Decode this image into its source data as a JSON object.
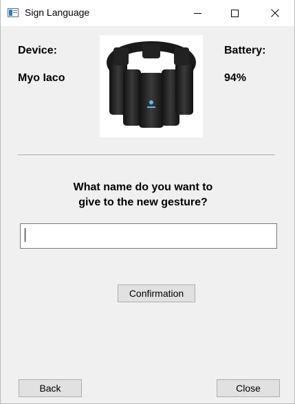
{
  "window": {
    "title": "Sign Language",
    "controls": {
      "minimize": "minimize-icon",
      "maximize": "maximize-icon",
      "close": "close-icon"
    }
  },
  "device": {
    "label": "Device:",
    "name": "Myo Iaco",
    "image_icon": "myo-armband-image"
  },
  "battery": {
    "label": "Battery:",
    "value": "94%"
  },
  "prompt": {
    "line1": "What name do you want to",
    "line2": "give to the new gesture?"
  },
  "gesture_name_input": {
    "value": "",
    "placeholder": ""
  },
  "buttons": {
    "confirm": "Confirmation",
    "back": "Back",
    "close": "Close"
  },
  "colors": {
    "window_bg": "#f0f0f0",
    "titlebar_bg": "#ffffff",
    "button_bg": "#e1e1e1",
    "button_border": "#adadad"
  }
}
